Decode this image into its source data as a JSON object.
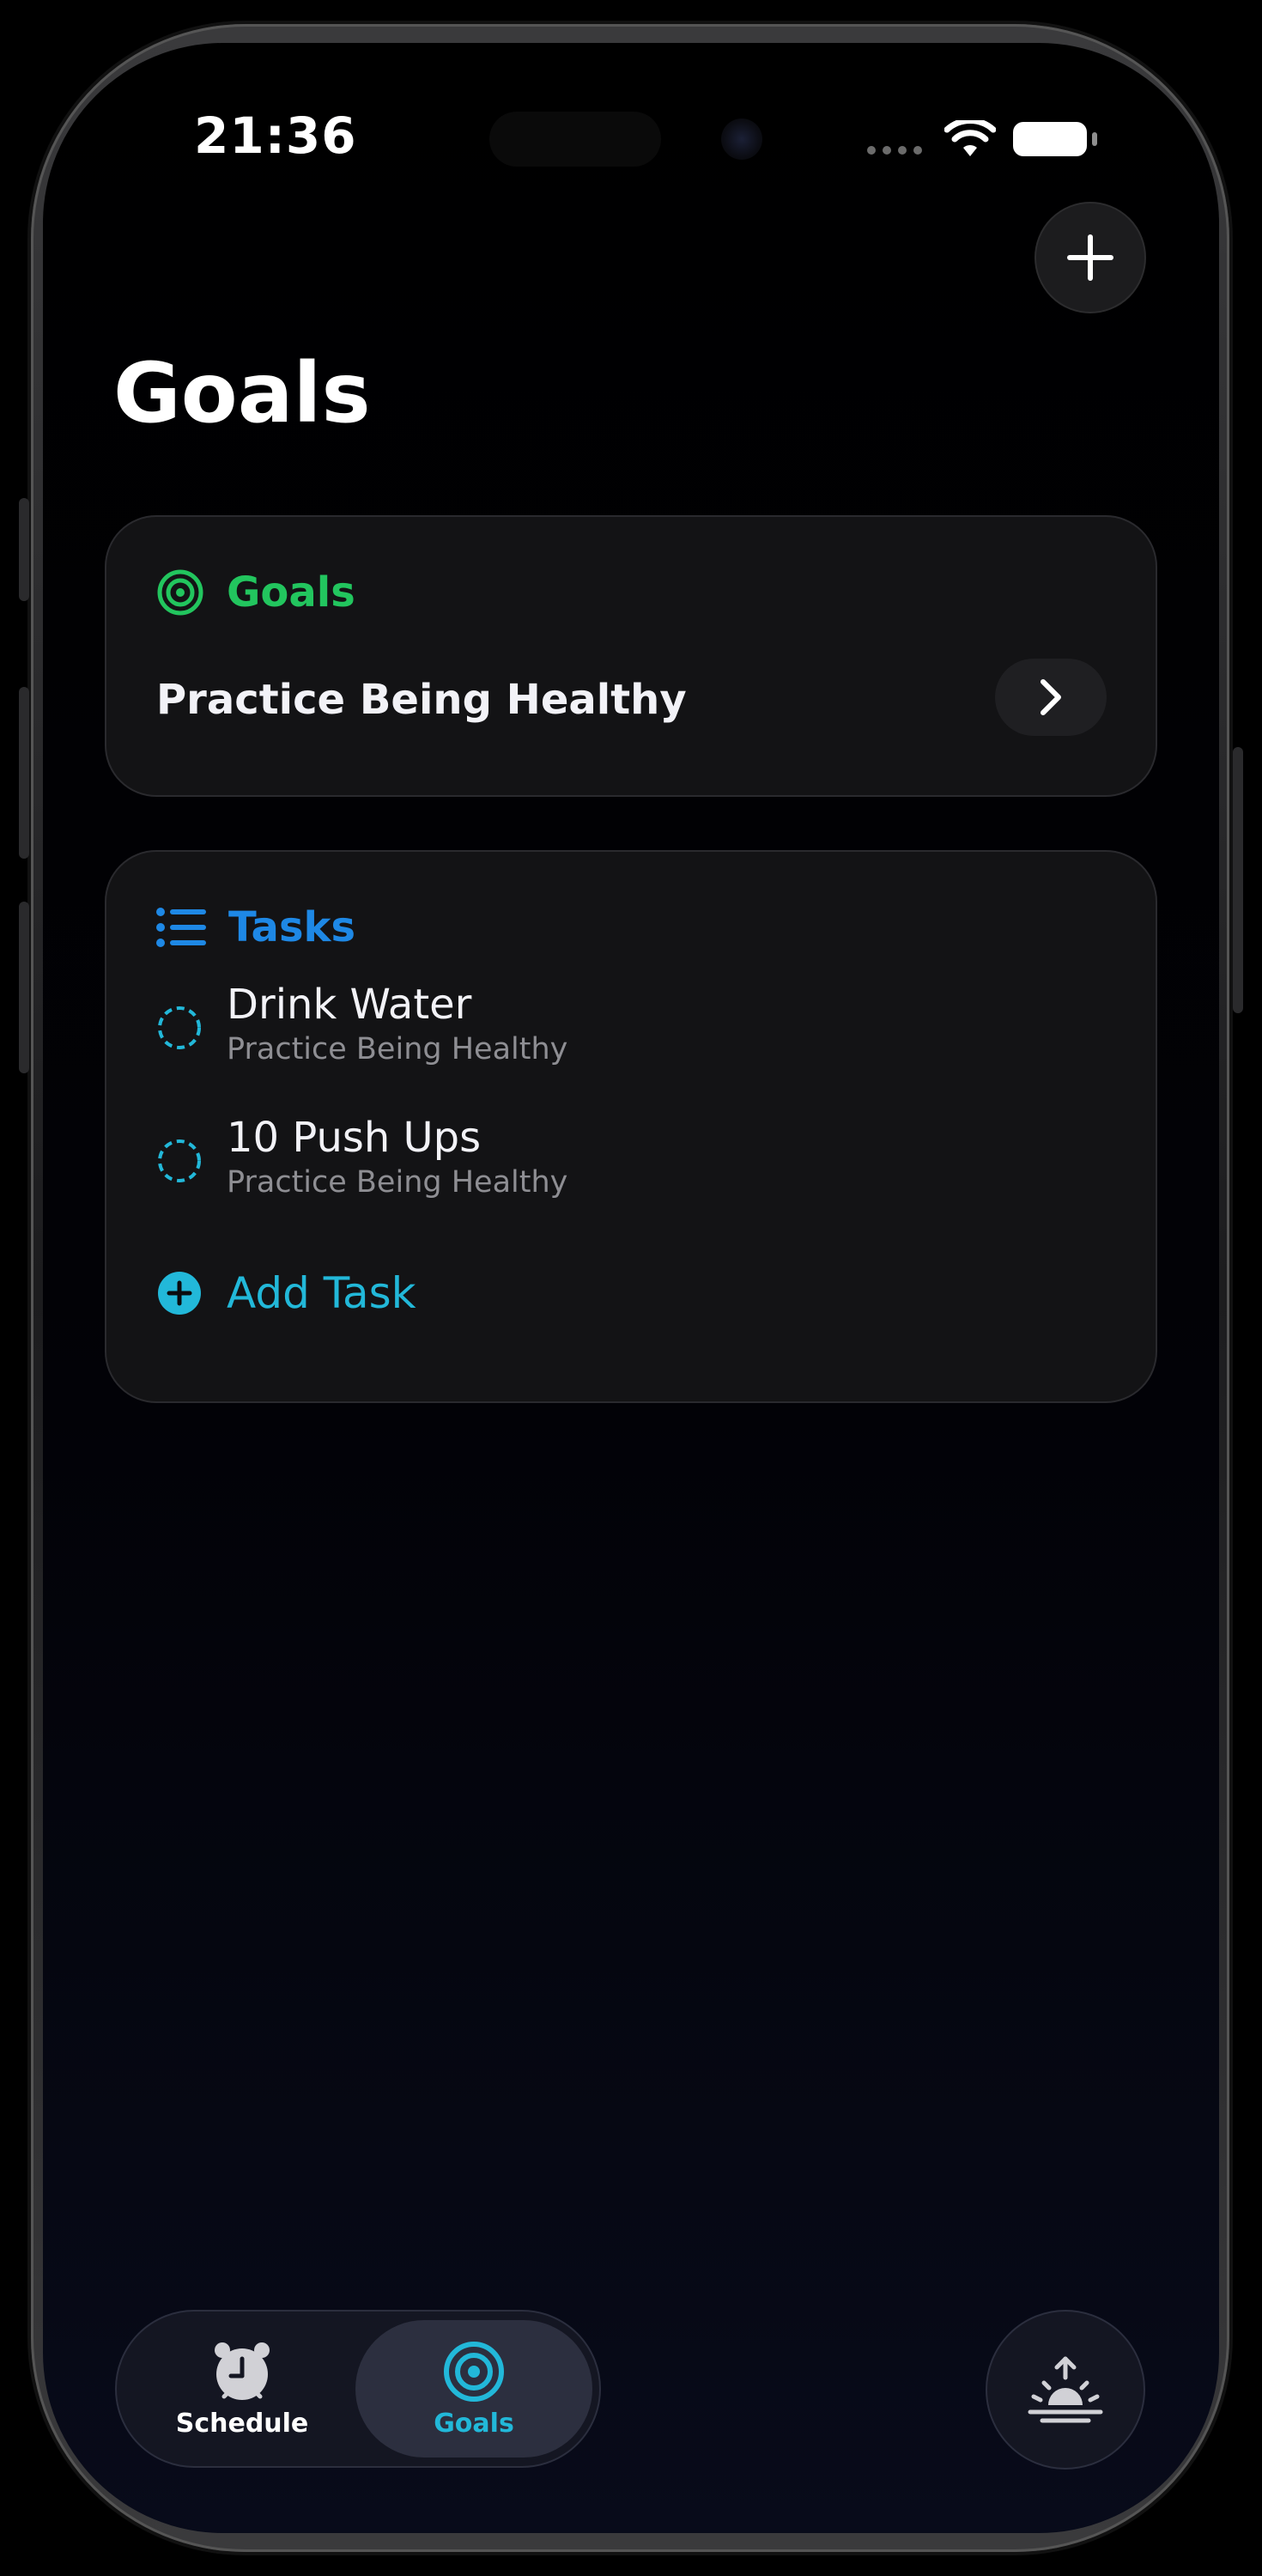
{
  "status_bar": {
    "time": "21:36"
  },
  "header": {
    "title": "Goals",
    "add_icon": "plus-icon"
  },
  "goals_card": {
    "label": "Goals",
    "icon": "target-icon",
    "accent_color": "#22c55e",
    "goal_name": "Practice Being Healthy",
    "chevron_icon": "chevron-right-icon"
  },
  "tasks_card": {
    "label": "Tasks",
    "icon": "list-icon",
    "accent_color": "#1e88e5",
    "tasks": [
      {
        "title": "Drink Water",
        "subtitle": "Practice Being Healthy"
      },
      {
        "title": "10 Push Ups",
        "subtitle": "Practice Being Healthy"
      }
    ],
    "add_task_label": "Add Task",
    "add_task_color": "#22b8d9"
  },
  "tab_bar": {
    "tabs": [
      {
        "label": "Schedule",
        "icon": "alarm-clock-icon",
        "active": false
      },
      {
        "label": "Goals",
        "icon": "target-icon",
        "active": true
      }
    ],
    "active_color": "#22b8d9",
    "inactive_color": "#ffffff"
  },
  "fab": {
    "icon": "sunrise-icon"
  }
}
